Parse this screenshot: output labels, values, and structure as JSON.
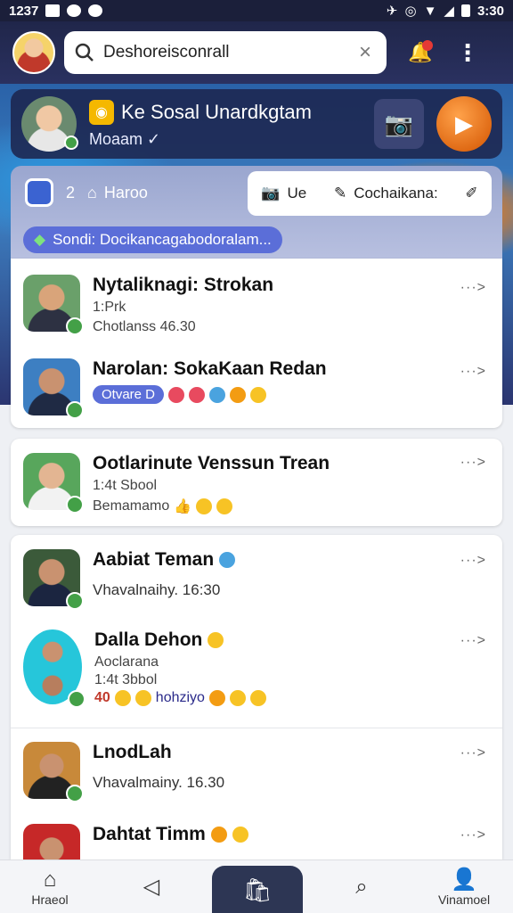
{
  "status_bar": {
    "time_left": "1237",
    "time_right": "3:30"
  },
  "header": {
    "search_value": "Deshoreisconrall",
    "clear": "×",
    "menu": "⋮"
  },
  "profile": {
    "title": "Ke Sosal Unardkgtam",
    "subtitle": "Moaam ✓"
  },
  "tabs": {
    "count": "2",
    "home_label": "Haroo",
    "action_1": "Ue",
    "action_2": "Cochaikana:",
    "chip": "Sondi: Docikancagabodoralam..."
  },
  "chats": [
    {
      "name": "Nytaliknagi: Strokan",
      "line1": "1:Prk",
      "line2": "Chotlanss 46.30"
    },
    {
      "name": "Narolan: SokaKaan Redan",
      "tag": "Otvare D"
    },
    {
      "name": "Ootlarinute Venssun Trean",
      "line1": "1:4t Sbool",
      "line2": "Bemamamo"
    },
    {
      "name": "Aabiat Teman",
      "line1": "Vhavalnaihy. 16:30"
    },
    {
      "name": "Dalla Dehon",
      "line1": "Aoclarana",
      "line2": "1:4t 3bbol",
      "line3_num": "40",
      "line3_text": "hohziyo"
    },
    {
      "name": "LnodLah",
      "line1": "Vhavalmainy. 16.30"
    },
    {
      "name": "Dahtat Timm"
    }
  ],
  "more_label": "···>",
  "nav": {
    "home": "Hraeol",
    "profile": "Vinamoel"
  }
}
